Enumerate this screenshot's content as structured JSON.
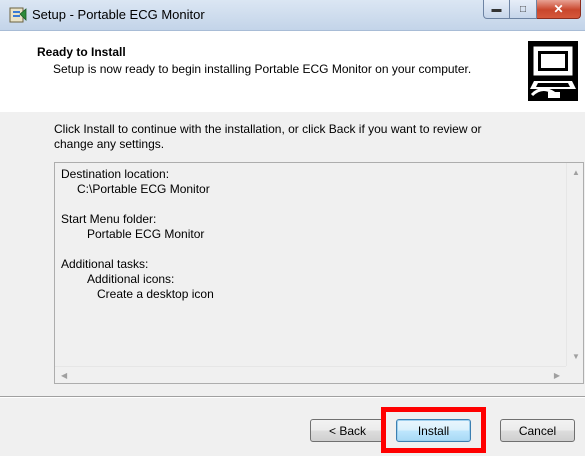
{
  "window": {
    "title": "Setup - Portable ECG Monitor",
    "minimize_icon": "minimize-icon",
    "maximize_icon": "maximize-icon",
    "close_icon": "close-icon",
    "app_icon": "setup-installer-icon"
  },
  "header": {
    "title": "Ready to Install",
    "subtitle": "Setup is now ready to begin installing Portable ECG Monitor on your computer.",
    "image_icon": "computer-install-icon"
  },
  "body": {
    "intro": "Click Install to continue with the installation, or click Back if you want to review or change any settings.",
    "memo": {
      "destination_label": "Destination location:",
      "destination_value": "C:\\Portable ECG Monitor",
      "start_menu_label": "Start Menu folder:",
      "start_menu_value": "Portable ECG Monitor",
      "tasks_label": "Additional tasks:",
      "tasks_group": "Additional icons:",
      "tasks_item": "Create a desktop icon"
    }
  },
  "buttons": {
    "back": "< Back",
    "install": "Install",
    "cancel": "Cancel"
  },
  "colors": {
    "highlight": "#ff0000",
    "dialog_bg": "#f0f0f0",
    "close_button": "#c9462c"
  }
}
